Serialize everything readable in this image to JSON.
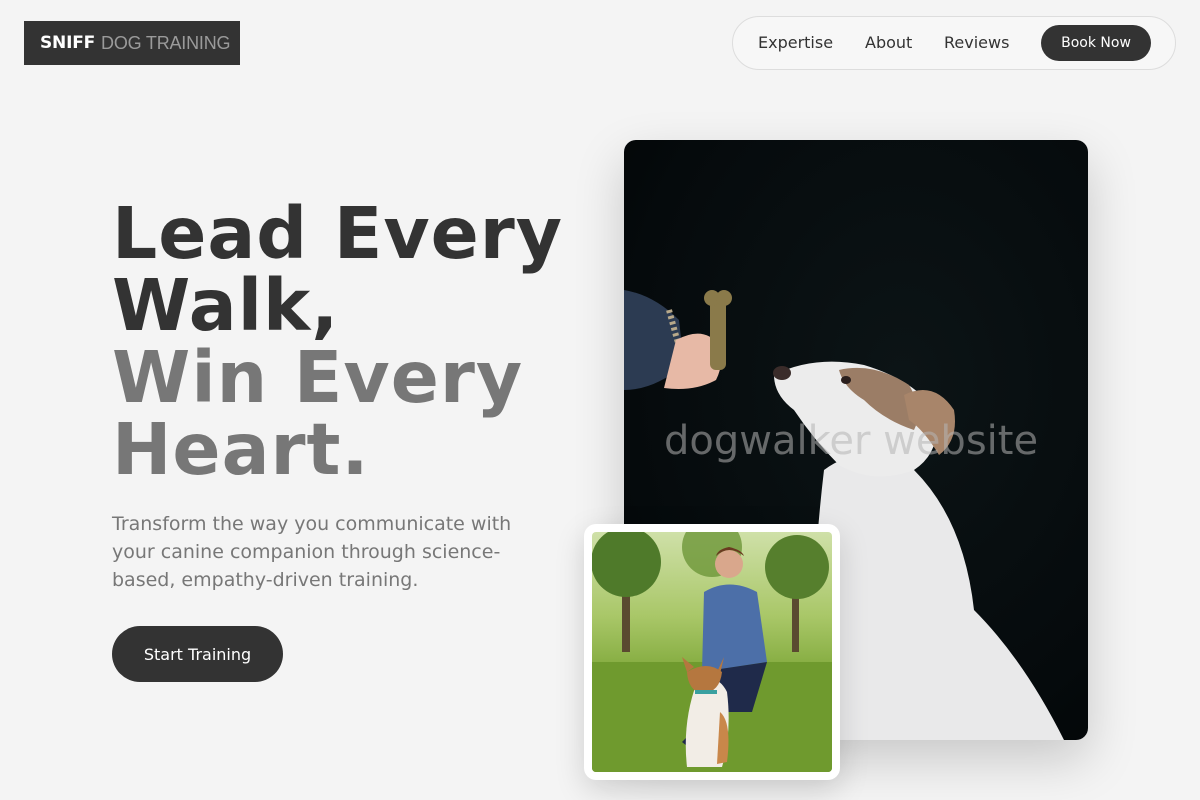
{
  "brand": {
    "bold": "SNIFF",
    "light": "DOG TRAINING"
  },
  "nav": {
    "links": [
      "Expertise",
      "About",
      "Reviews"
    ],
    "cta": "Book Now"
  },
  "hero": {
    "line1": "Lead Every",
    "line2": "Walk,",
    "line3": "Win Every",
    "line4": "Heart.",
    "subtext": "Transform the way you communicate with your canine companion through science-based, empathy-driven training.",
    "cta": "Start Training"
  },
  "images": {
    "main_alt": "Dog looking up at a treat held by a hand on a dark background",
    "watermark": "dogwalker website",
    "secondary_alt": "Man kneeling with a dog in a sunny park"
  },
  "colors": {
    "dark": "#333333",
    "grey": "#777777",
    "background": "#f4f4f4"
  }
}
